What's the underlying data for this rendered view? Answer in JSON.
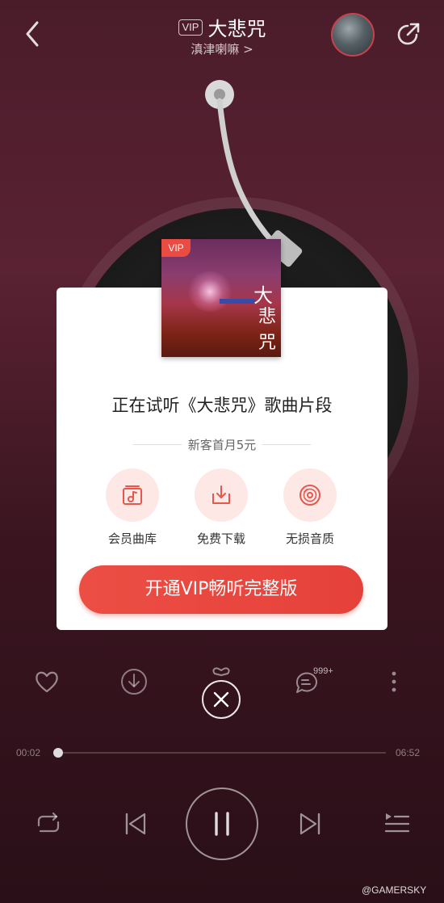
{
  "header": {
    "vip_badge": "VIP",
    "song_title": "大悲咒",
    "artist": "滇津喇嘛 >"
  },
  "album": {
    "vip_badge": "VIP",
    "cover_chars": [
      "大",
      "悲咒"
    ]
  },
  "modal": {
    "trial_text": "正在试听《大悲咒》歌曲片段",
    "promo_text": "新客首月5元",
    "features": [
      {
        "label": "会员曲库",
        "icon": "music-library-icon"
      },
      {
        "label": "免费下载",
        "icon": "download-icon"
      },
      {
        "label": "无损音质",
        "icon": "lossless-disc-icon"
      }
    ],
    "cta_label": "开通VIP畅听完整版"
  },
  "actions": {
    "comment_count": "999+"
  },
  "progress": {
    "current_time": "00:02",
    "total_time": "06:52",
    "fraction": 0.005
  },
  "watermark": "@GAMERSKY",
  "colors": {
    "accent": "#e5413a",
    "feature_bg": "#fde8e6"
  }
}
